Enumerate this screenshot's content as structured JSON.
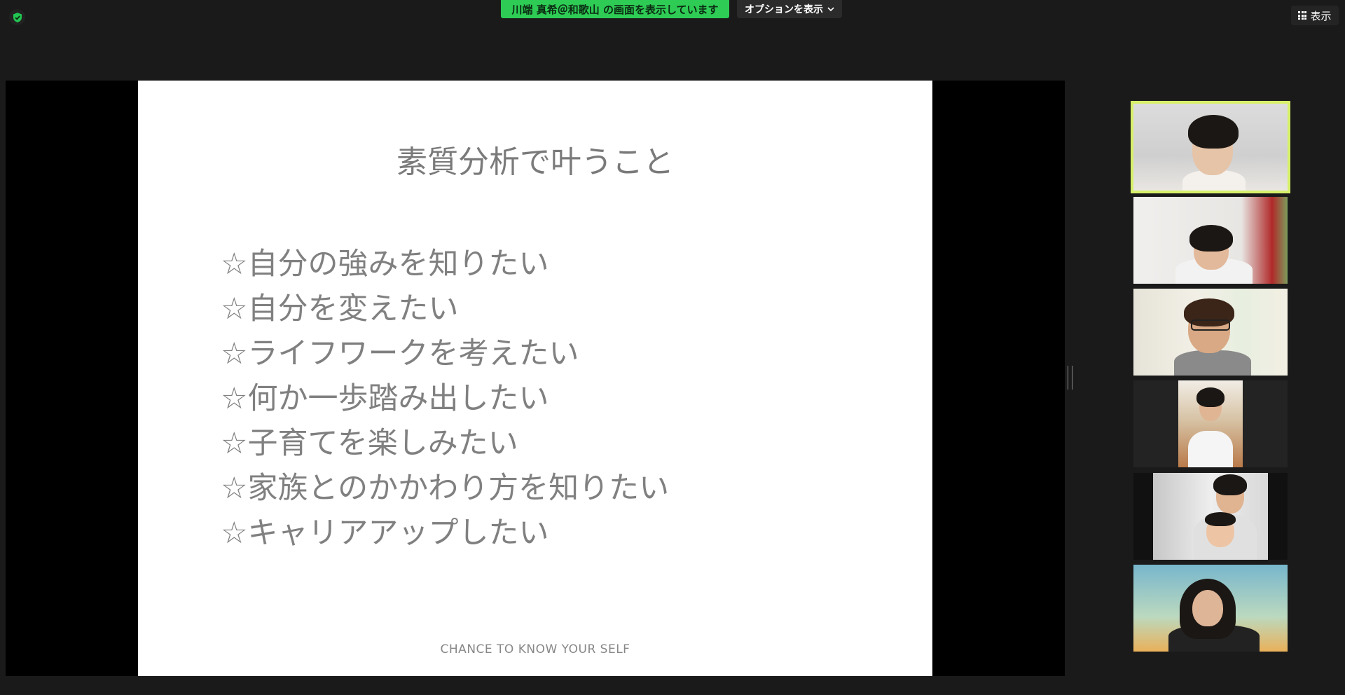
{
  "top_bar": {
    "share_banner_text": "川端 真希＠和歌山 の画面を表示しています",
    "options_label": "オプションを表示",
    "view_label": "表示"
  },
  "slide": {
    "title": "素質分析で叶うこと",
    "items": [
      "☆自分の強みを知りたい",
      "☆自分を変えたい",
      "☆ライフワークを考えたい",
      "☆何か一歩踏み出したい",
      "☆子育てを楽しみたい",
      "☆家族とのかかわり方を知りたい",
      "☆キャリアアップしたい"
    ],
    "footer": "CHANCE TO KNOW YOUR SELF"
  },
  "colors": {
    "banner_green": "#2ecc55",
    "active_speaker_border": "#d7f06a",
    "background": "#1a1a1a"
  }
}
